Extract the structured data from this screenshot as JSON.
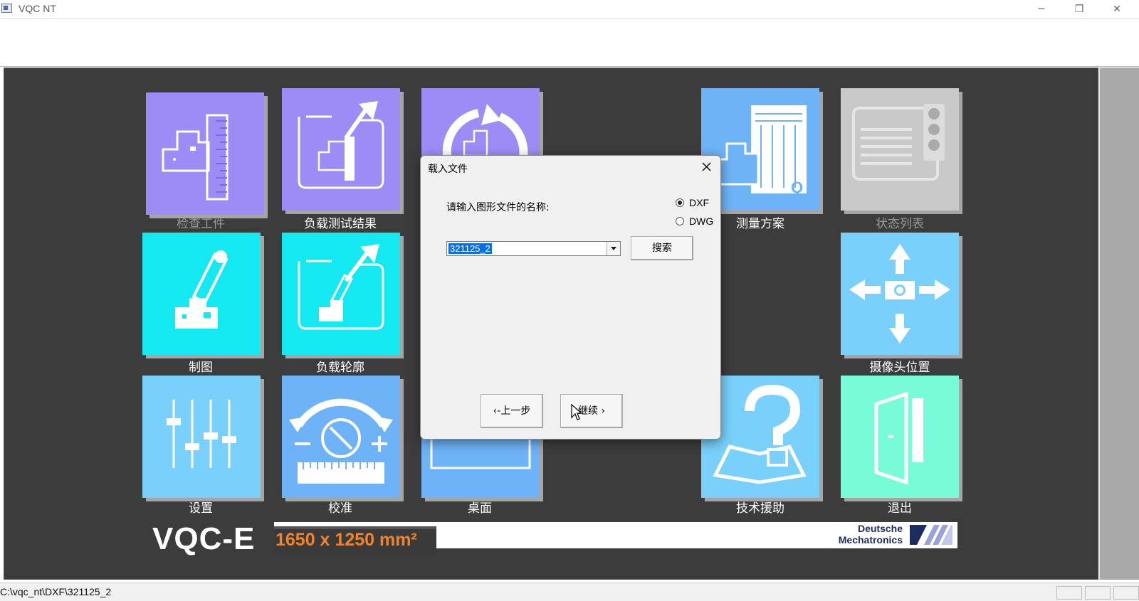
{
  "window": {
    "title": "VQC NT",
    "minimize": "─",
    "restore": "❐",
    "close": "✕"
  },
  "tiles": [
    {
      "id": "check",
      "label": "检查工件",
      "color": "#9d8cf6",
      "icon": "ruler-part-icon",
      "dim": true
    },
    {
      "id": "loadresult",
      "label": "负载测试结果",
      "color": "#9d8cf6",
      "icon": "load-result-icon",
      "dim": false
    },
    {
      "id": "third",
      "label": "",
      "color": "#9d8cf6",
      "icon": "rotate-icon",
      "dim": false
    },
    {
      "id": "plan",
      "label": "测量方案",
      "color": "#6eb3f7",
      "icon": "measure-plan-icon",
      "dim": false
    },
    {
      "id": "statuslist",
      "label": "状态列表",
      "color": "#c9c9c9",
      "icon": "status-list-icon",
      "dim": true
    },
    {
      "id": "draw",
      "label": "制图",
      "color": "#14e9f2",
      "icon": "draw-pencil-icon",
      "dim": false
    },
    {
      "id": "loadcontour",
      "label": "负载轮廓",
      "color": "#14e9f2",
      "icon": "load-contour-icon",
      "dim": false
    },
    {
      "id": "camera",
      "label": "摄像头位置",
      "color": "#78d0fb",
      "icon": "camera-move-icon",
      "dim": false
    },
    {
      "id": "settings",
      "label": "设置",
      "color": "#78d0fb",
      "icon": "sliders-icon",
      "dim": false
    },
    {
      "id": "calibrate",
      "label": "校准",
      "color": "#6eb3f7",
      "icon": "calibrate-icon",
      "dim": false
    },
    {
      "id": "desktop",
      "label": "桌面",
      "color": "#6eb3f7",
      "icon": "desktop-icon",
      "dim": false
    },
    {
      "id": "help",
      "label": "技术援助",
      "color": "#78d0fb",
      "icon": "help-book-icon",
      "dim": false
    },
    {
      "id": "exit",
      "label": "退出",
      "color": "#78fcd8",
      "icon": "exit-door-icon",
      "dim": false
    }
  ],
  "branding": {
    "product": "VQC-E",
    "size": "1650 x 1250 mm²",
    "company_line1": "Deutsche",
    "company_line2": "Mechatronics"
  },
  "status": {
    "path": "C:\\vqc_nt\\DXF\\321125_2"
  },
  "dialog": {
    "title": "载入文件",
    "prompt": "请输入图形文件的名称:",
    "format_dxf": "DXF",
    "format_dwg": "DWG",
    "selected_format": "DXF",
    "filename": "321125_2",
    "search_label": "搜索",
    "back_label": "‹-上一步",
    "continue_label": "继续 ›"
  }
}
